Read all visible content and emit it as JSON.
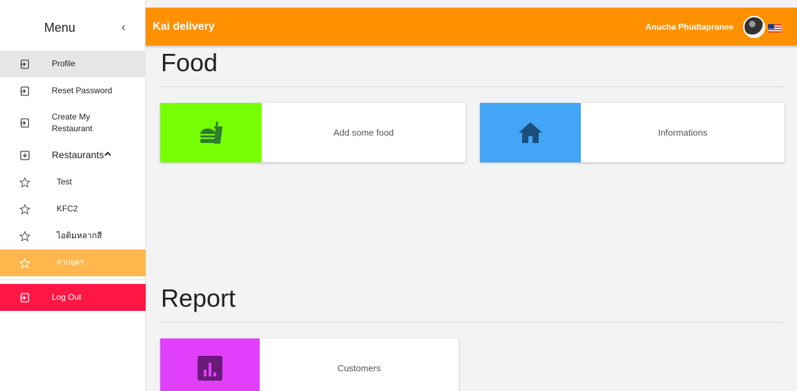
{
  "sidebar": {
    "title": "Menu",
    "collapse_glyph": "‹",
    "items": [
      {
        "label": "Profile",
        "icon": "login-icon"
      },
      {
        "label": "Reset Password",
        "icon": "login-icon"
      },
      {
        "label": "Create My Restaurant",
        "icon": "login-icon"
      }
    ],
    "restaurants_section": {
      "label": "Restaurants",
      "icon": "download-box-icon",
      "chevron": "^"
    },
    "restaurants": [
      {
        "label": "Test",
        "icon": "star-outline-icon"
      },
      {
        "label": "KFC2",
        "icon": "star-outline-icon"
      },
      {
        "label": "ไอติมหลากสี",
        "icon": "star-outline-icon"
      },
      {
        "label": "ลาบอุดร",
        "icon": "star-outline-icon"
      }
    ],
    "logout": {
      "label": "Log Out",
      "icon": "login-icon"
    }
  },
  "topbar": {
    "brand": "Kai delivery",
    "username": "Anucha Phudtapranee",
    "avatar_icon": "avatar",
    "flag_icon": "us-flag-icon"
  },
  "sections": {
    "food": {
      "title": "Food",
      "cards": [
        {
          "label": "Add some food",
          "icon": "fastfood-icon",
          "color": "#76ff03"
        },
        {
          "label": "Informations",
          "icon": "home-icon",
          "color": "#42a5f5"
        }
      ]
    },
    "report": {
      "title": "Report",
      "cards": [
        {
          "label": "Customers",
          "icon": "bar-chart-icon",
          "color": "#e040fb"
        }
      ]
    }
  },
  "colors": {
    "topbar": "#ff9100",
    "selected": "#ffb74d",
    "logout": "#ff1744",
    "food_icon": "#2e7d32",
    "home_icon": "#1a4f7a",
    "report_icon": "#6a1b7a"
  }
}
